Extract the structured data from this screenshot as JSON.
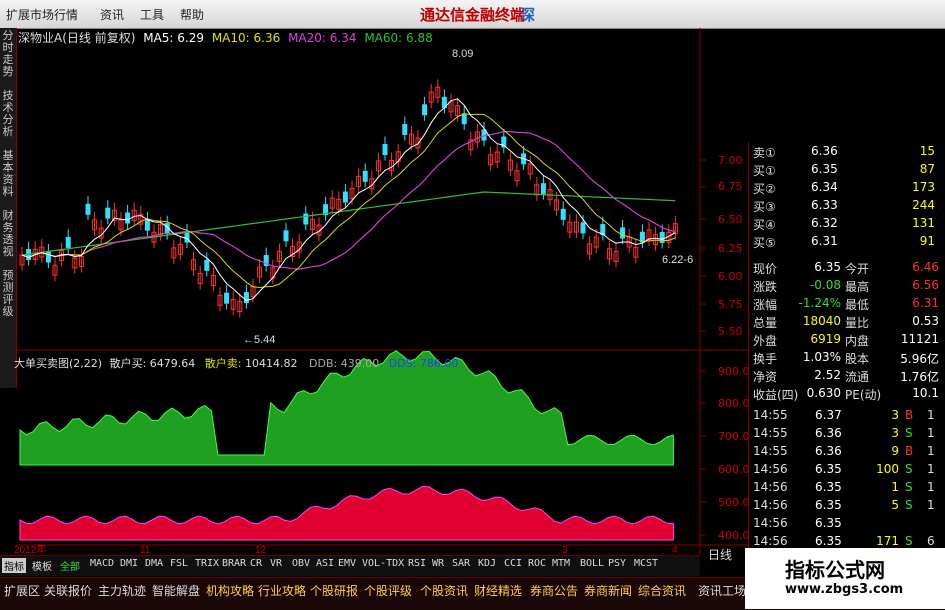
{
  "menu": {
    "items": [
      "扩展市场行情",
      "资讯",
      "工具",
      "帮助"
    ],
    "brand": "通达信金融终端",
    "brand_tail": "深"
  },
  "sidebar": [
    "分时走势",
    "技术分析",
    "基本资料",
    "财务透视",
    "预测评级"
  ],
  "main": {
    "title": "深物业A(日线 前复权)",
    "ma5": "MA5: 6.29",
    "ma10": "MA10: 6.36",
    "ma20": "MA20: 6.34",
    "ma60": "MA60: 6.88",
    "high_label": "8.09",
    "low_label": "←5.44",
    "right_label": "6.22-6",
    "y_ticks": [
      "7.00",
      "6.75",
      "6.50",
      "6.25",
      "6.00",
      "5.75",
      "5.50"
    ]
  },
  "sub": {
    "title": "大单买卖图(2,22)",
    "retail_buy_label": "散户买:",
    "retail_buy": "6479.64",
    "retail_sell_label": "散户卖:",
    "retail_sell": "10414.82",
    "ddb": "DDB: 439.00",
    "dds": "DDS: 786.00",
    "y_ticks": [
      "900.00",
      "800.00",
      "700.00",
      "600.00",
      "500.00",
      "400.00"
    ]
  },
  "dates": [
    "2012年",
    "11",
    "12",
    "3",
    "4"
  ],
  "quote": {
    "levels": [
      {
        "side": "卖①",
        "price": "6.36",
        "vol": "15"
      },
      {
        "side": "买①",
        "price": "6.35",
        "vol": "87"
      },
      {
        "side": "买②",
        "price": "6.34",
        "vol": "173"
      },
      {
        "side": "买③",
        "price": "6.33",
        "vol": "244"
      },
      {
        "side": "买④",
        "price": "6.32",
        "vol": "131"
      },
      {
        "side": "买⑤",
        "price": "6.31",
        "vol": "91"
      }
    ],
    "stats": [
      [
        "现价",
        "6.35",
        "今开",
        "6.46"
      ],
      [
        "涨跌",
        "-0.08",
        "最高",
        "6.56"
      ],
      [
        "涨幅",
        "-1.24%",
        "最低",
        "6.31"
      ],
      [
        "总量",
        "18040",
        "量比",
        "0.53"
      ],
      [
        "外盘",
        "6919",
        "内盘",
        "11121"
      ],
      [
        "换手",
        "1.03%",
        "股本",
        "5.96亿"
      ],
      [
        "净资",
        "2.52",
        "流通",
        "1.76亿"
      ],
      [
        "收益(四)",
        "0.630",
        "PE(动)",
        "10.1"
      ]
    ],
    "ticks": [
      [
        "14:55",
        "6.37",
        "3",
        "B",
        "1"
      ],
      [
        "14:55",
        "6.36",
        "3",
        "S",
        "1"
      ],
      [
        "14:55",
        "6.36",
        "9",
        "B",
        "1"
      ],
      [
        "14:56",
        "6.35",
        "100",
        "S",
        "1"
      ],
      [
        "14:56",
        "6.35",
        "1",
        "S",
        "1"
      ],
      [
        "14:56",
        "6.35",
        "5",
        "S",
        "1"
      ],
      [
        "14:56",
        "6.35",
        "",
        "",
        ""
      ],
      [
        "14:56",
        "6.35",
        "171",
        "S",
        "6"
      ]
    ],
    "period": "日线"
  },
  "tabs": [
    "指标",
    "模板",
    "全部",
    "MACD",
    "DMI",
    "DMA",
    "FSL",
    "TRIX",
    "BRAR",
    "CR",
    "VR",
    "OBV",
    "ASI",
    "EMV",
    "VOL-TDX",
    "RSI",
    "WR",
    "SAR",
    "KDJ",
    "CCI",
    "ROC",
    "MTM",
    "BOLL",
    "PSY",
    "MCST"
  ],
  "bottom": [
    "扩展区",
    "关联报价",
    "主力轨迹",
    "智能解盘",
    "机构攻略",
    "行业攻略",
    "个股研报",
    "个股评级",
    "个股资讯",
    "财经精选",
    "券商公告",
    "券商新闻",
    "综合资讯",
    "资讯工场"
  ],
  "watermark": {
    "title": "指标公式网",
    "url": "www.zbgs3.com"
  },
  "colors": {
    "up": "#ff3030",
    "down": "#30e0ff",
    "ma5": "#ffffff",
    "ma10": "#e0e000",
    "ma20": "#e040e0",
    "ma60": "#30c030",
    "green_area": "#20a020",
    "red_area": "#e00030"
  }
}
